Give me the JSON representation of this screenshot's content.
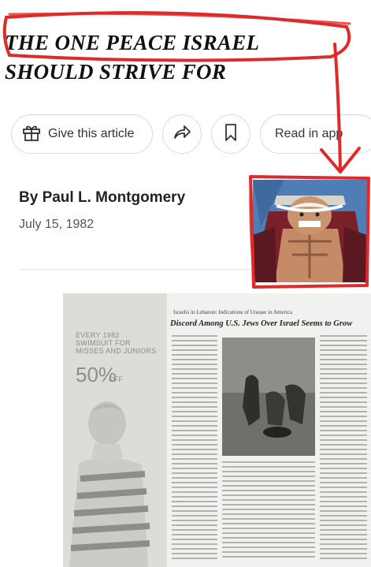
{
  "headline": {
    "line1": "THE ONE PEACE ISRAEL",
    "line2": "SHOULD STRIVE FOR"
  },
  "toolbar": {
    "gift_label": "Give this article",
    "read_in_app_label": "Read in app"
  },
  "article": {
    "byline": "By Paul L. Montgomery",
    "date": "July 15, 1982"
  },
  "scan": {
    "ad_text_lines": [
      "EVERY 1982",
      "SWIMSUIT FOR",
      "MISSES AND JUNIORS"
    ],
    "ad_percent": "50%",
    "ad_off": "OFF",
    "paper_top": "Israelis in Lebanon: Indications of Unease in America",
    "paper_headline": "Discord Among U.S. Jews Over Israel Seems to Grow"
  },
  "colors": {
    "annotation_red": "#e02a2a",
    "pill_border": "#d9d9d9",
    "thumb_bg": "#4d7bb5"
  },
  "icons": [
    "gift-icon",
    "share-icon",
    "bookmark-icon"
  ]
}
